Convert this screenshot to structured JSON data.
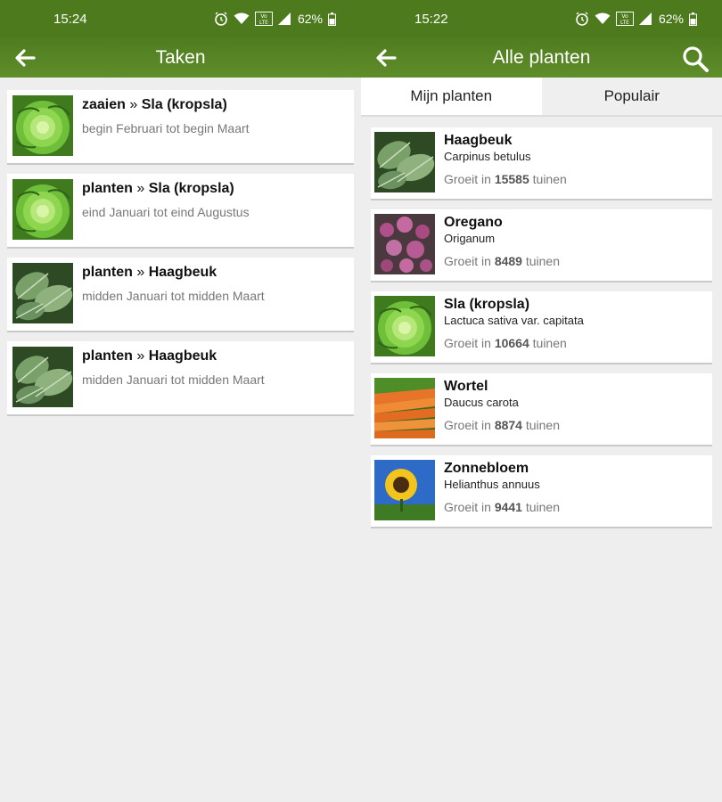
{
  "left": {
    "status": {
      "time": "15:24",
      "battery": "62%"
    },
    "appbar": {
      "title": "Taken"
    },
    "tasks": [
      {
        "action": "zaaien",
        "separator": "»",
        "plant": "Sla (kropsla)",
        "period": "begin Februari tot begin Maart",
        "image": "lettuce"
      },
      {
        "action": "planten",
        "separator": "»",
        "plant": "Sla (kropsla)",
        "period": "eind Januari tot eind Augustus",
        "image": "lettuce"
      },
      {
        "action": "planten",
        "separator": "»",
        "plant": "Haagbeuk",
        "period": "midden Januari tot midden Maart",
        "image": "hornbeam"
      },
      {
        "action": "planten",
        "separator": "»",
        "plant": "Haagbeuk",
        "period": "midden Januari tot midden Maart",
        "image": "hornbeam"
      }
    ]
  },
  "right": {
    "status": {
      "time": "15:22",
      "battery": "62%"
    },
    "appbar": {
      "title": "Alle planten"
    },
    "tabs": [
      {
        "label": "Mijn planten",
        "active": true
      },
      {
        "label": "Populair",
        "active": false
      }
    ],
    "plants": [
      {
        "name": "Haagbeuk",
        "latin": "Carpinus betulus",
        "grow_prefix": "Groeit in",
        "count": "15585",
        "grow_suffix": "tuinen",
        "image": "hornbeam"
      },
      {
        "name": "Oregano",
        "latin": "Origanum",
        "grow_prefix": "Groeit in",
        "count": "8489",
        "grow_suffix": "tuinen",
        "image": "oregano"
      },
      {
        "name": "Sla (kropsla)",
        "latin": "Lactuca sativa var. capitata",
        "grow_prefix": "Groeit in",
        "count": "10664",
        "grow_suffix": "tuinen",
        "image": "lettuce"
      },
      {
        "name": "Wortel",
        "latin": "Daucus carota",
        "grow_prefix": "Groeit in",
        "count": "8874",
        "grow_suffix": "tuinen",
        "image": "carrot"
      },
      {
        "name": "Zonnebloem",
        "latin": "Helianthus annuus",
        "grow_prefix": "Groeit in",
        "count": "9441",
        "grow_suffix": "tuinen",
        "image": "sunflower"
      }
    ]
  },
  "colors": {
    "statusbar": "#4d7a1d",
    "appbar": "#5a8a26",
    "background": "#eeeeee"
  },
  "icons": {
    "back": "arrow-left-icon",
    "search": "search-icon",
    "alarm": "alarm-icon",
    "wifi": "wifi-icon",
    "volte": "volte-icon",
    "signal": "signal-icon",
    "battery": "battery-icon"
  }
}
